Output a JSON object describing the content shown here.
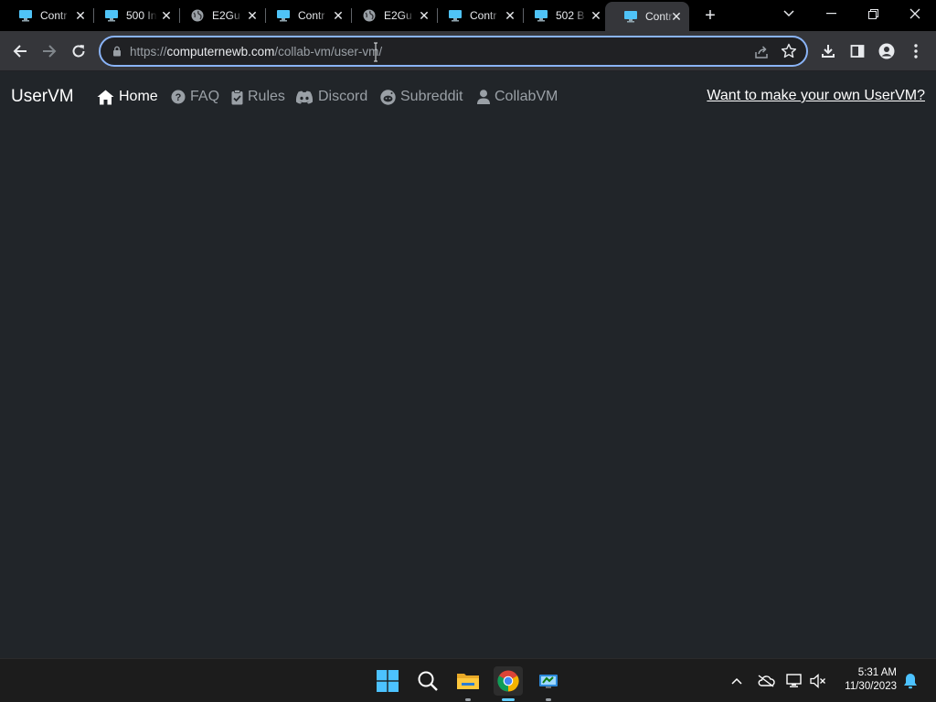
{
  "tabs": [
    {
      "title": "Contr",
      "icon": "monitor-icon",
      "active": false
    },
    {
      "title": "500 In",
      "icon": "monitor-icon",
      "active": false
    },
    {
      "title": "E2Gu",
      "icon": "globe-icon",
      "active": false
    },
    {
      "title": "Contr",
      "icon": "monitor-icon",
      "active": false
    },
    {
      "title": "E2Gu",
      "icon": "globe-icon",
      "active": false
    },
    {
      "title": "Contr",
      "icon": "monitor-icon",
      "active": false
    },
    {
      "title": "502 B",
      "icon": "monitor-icon",
      "active": false
    },
    {
      "title": "Contr",
      "icon": "monitor-icon",
      "active": true
    }
  ],
  "omnibox": {
    "scheme": "https://",
    "host": "computernewb.com",
    "path": "/collab-vm/user-vm/"
  },
  "page": {
    "brand": "UserVM",
    "nav": [
      {
        "label": "Home",
        "icon": "home-icon",
        "active": true
      },
      {
        "label": "FAQ",
        "icon": "question-circle-icon",
        "active": false
      },
      {
        "label": "Rules",
        "icon": "clipboard-check-icon",
        "active": false
      },
      {
        "label": "Discord",
        "icon": "discord-icon",
        "active": false
      },
      {
        "label": "Subreddit",
        "icon": "reddit-icon",
        "active": false
      },
      {
        "label": "CollabVM",
        "icon": "user-icon",
        "active": false
      }
    ],
    "cta": "Want to make your own UserVM?"
  },
  "taskbar": {
    "apps": [
      "windows-start-icon",
      "search-icon",
      "file-explorer-icon",
      "chrome-icon",
      "vm-app-icon"
    ],
    "time": "5:31 AM",
    "date": "11/30/2023"
  },
  "colors": {
    "page_bg": "#212529",
    "toolbar_bg": "#35363a",
    "focus_ring": "#8ab4f8",
    "nav_muted": "#9aa0a6",
    "taskbar_bg": "#1c1c1c",
    "accent": "#60cdff"
  }
}
